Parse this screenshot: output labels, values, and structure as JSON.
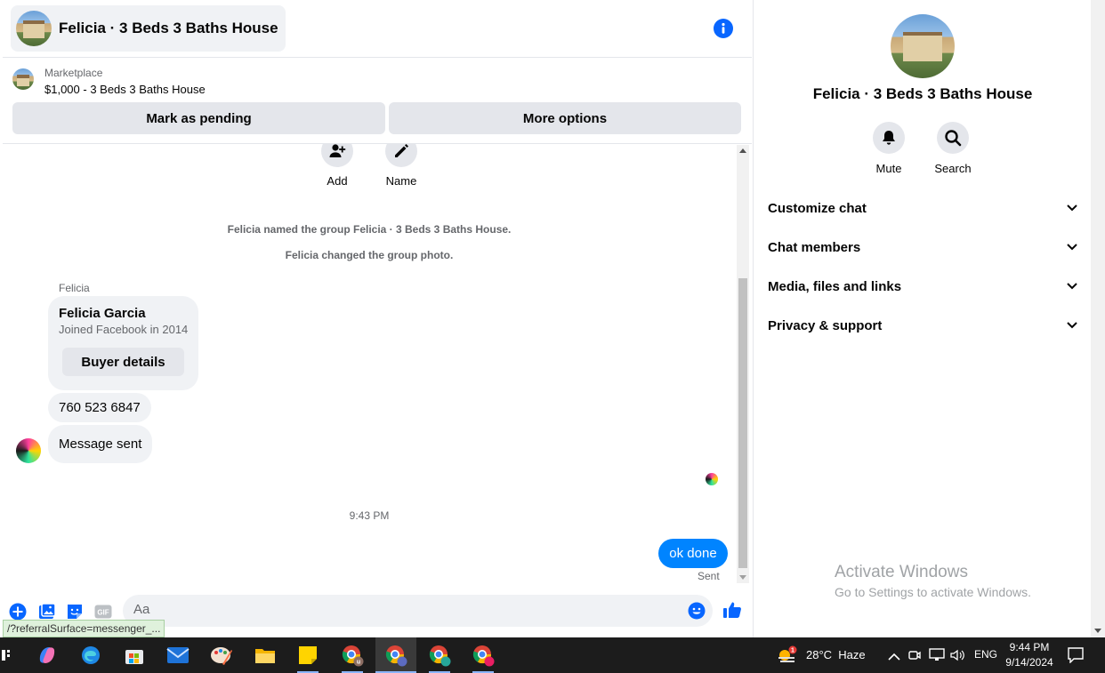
{
  "header": {
    "title": "Felicia · 3 Beds 3 Baths House"
  },
  "marketplace": {
    "label": "Marketplace",
    "listing": "$1,000 - 3 Beds 3 Baths House",
    "pending_button": "Mark as pending",
    "more_button": "More options"
  },
  "actions": [
    {
      "label": "Add",
      "icon": "add-person-icon"
    },
    {
      "label": "Name",
      "icon": "pencil-icon"
    }
  ],
  "system_messages": [
    "Felicia named the group Felicia · 3 Beds 3 Baths House.",
    "Felicia changed the group photo."
  ],
  "thread": {
    "sender_name": "Felicia",
    "card": {
      "name": "Felicia Garcia",
      "subtitle": "Joined Facebook in 2014",
      "button": "Buyer details"
    },
    "msg_phone": "760 523 6847",
    "msg_sent_text": "Message sent",
    "timestamp": "9:43 PM",
    "outgoing": "ok done",
    "status": "Sent"
  },
  "composer": {
    "placeholder": "Aa",
    "gif_label": "GIF"
  },
  "status_url": "/?referralSurface=messenger_...",
  "right_panel": {
    "title": "Felicia · 3 Beds 3 Baths House",
    "mute": "Mute",
    "search": "Search",
    "sections": [
      "Customize chat",
      "Chat members",
      "Media, files and links",
      "Privacy & support"
    ]
  },
  "watermark": {
    "line1": "Activate Windows",
    "line2": "Go to Settings to activate Windows."
  },
  "taskbar": {
    "notification_count": "1",
    "weather": "28°C  Haze",
    "lang": "ENG",
    "time": "9:44 PM",
    "date": "9/14/2024",
    "chrome_badge": "u"
  },
  "colors": {
    "accent": "#0084ff",
    "bubble_gray": "#f0f2f5",
    "button_gray": "#e4e6eb",
    "taskbar": "#1c1c1c"
  }
}
